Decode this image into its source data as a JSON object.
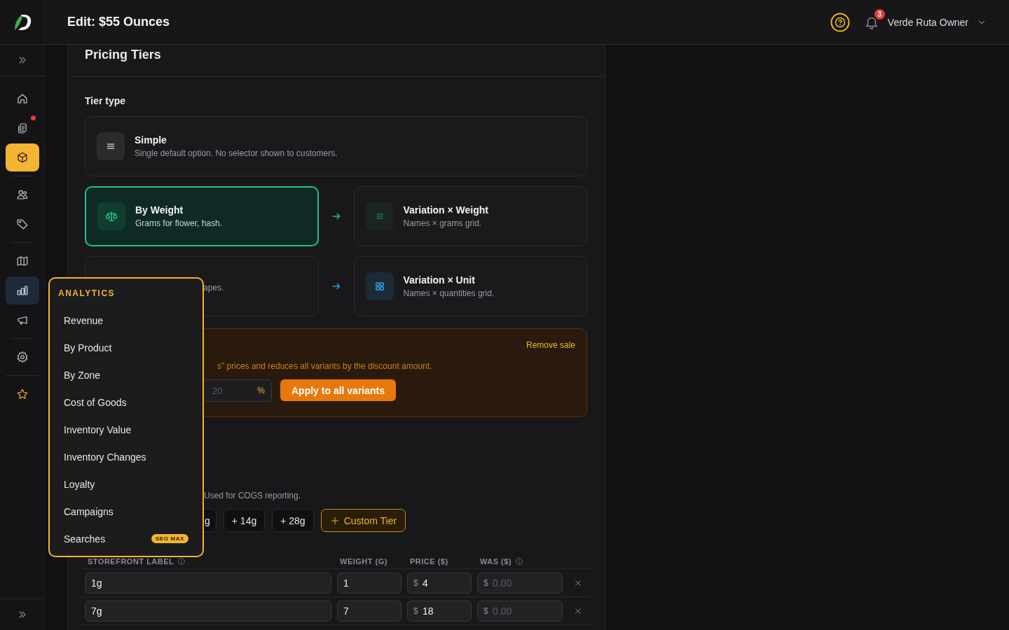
{
  "header": {
    "title": "Edit: $55 Ounces",
    "notifications": "3",
    "user": "Verde Ruta Owner"
  },
  "sidebar": {
    "groups": [
      [
        {
          "selected": false,
          "expanded": false,
          "dot": false
        },
        {
          "selected": false,
          "expanded": false,
          "dot": true
        },
        {
          "selected": true,
          "expanded": false,
          "dot": false
        }
      ],
      [
        {
          "selected": false,
          "expanded": false,
          "dot": false
        },
        {
          "selected": false,
          "expanded": false,
          "dot": false
        }
      ],
      [
        {
          "selected": false,
          "expanded": false,
          "dot": false
        },
        {
          "selected": false,
          "expanded": true,
          "dot": false
        },
        {
          "selected": false,
          "expanded": false,
          "dot": false
        }
      ],
      [
        {
          "selected": false,
          "expanded": false,
          "dot": false
        }
      ],
      [
        {
          "selected": false,
          "expanded": false,
          "dot": false
        }
      ]
    ]
  },
  "panel": {
    "title": "Pricing Tiers",
    "tier_label": "Tier type",
    "simple": {
      "title": "Simple",
      "subtitle": "Single default option. No selector shown to customers.",
      "selected": false,
      "color": "#9a9aa0"
    },
    "pairs": [
      {
        "left": {
          "title": "By Weight",
          "subtitle": "Grams for flower, hash.",
          "selected": true,
          "color": "#1fbf85"
        },
        "right": {
          "title": "Variation × Weight",
          "subtitle": "Names × grams grid.",
          "selected": false,
          "color": "#1a6b4c"
        }
      },
      {
        "left": {
          "subtitle": "apes.",
          "selected": false,
          "color": "#2a9fd8"
        },
        "right": {
          "title": "Variation × Unit",
          "subtitle": "Names × quantities grid.",
          "selected": false,
          "color": "#2a9fd8"
        }
      }
    ],
    "sale": {
      "remove": "Remove sale",
      "description": "s\" prices and reduces all variants by the discount amount.",
      "field": {
        "placeholder": "20",
        "suffix": "%"
      },
      "apply": "Apply to all variants"
    },
    "cost_hint": "Used for COGS reporting.",
    "chips": [
      "g",
      "+ 14g",
      "+ 28g"
    ],
    "custom_tier": "Custom Tier",
    "table": {
      "columns": [
        "STOREFRONT LABEL",
        "WEIGHT (G)",
        "PRICE ($)",
        "WAS ($)"
      ],
      "rows": [
        {
          "label": "1g",
          "weight": "1",
          "price_prefix": "$",
          "price": "4",
          "was_prefix": "$",
          "was_placeholder": "0.00"
        },
        {
          "label": "7g",
          "weight": "7",
          "price_prefix": "$",
          "price": "18",
          "was_prefix": "$",
          "was_placeholder": "0.00"
        }
      ]
    }
  },
  "menu": {
    "title": "ANALYTICS",
    "items": [
      {
        "label": "Revenue"
      },
      {
        "label": "By Product"
      },
      {
        "label": "By Zone"
      },
      {
        "label": "Cost of Goods"
      },
      {
        "label": "Inventory Value"
      },
      {
        "label": "Inventory Changes"
      },
      {
        "label": "Loyalty"
      },
      {
        "label": "Campaigns"
      },
      {
        "label": "Searches",
        "badge": "SEO MAX"
      }
    ]
  }
}
